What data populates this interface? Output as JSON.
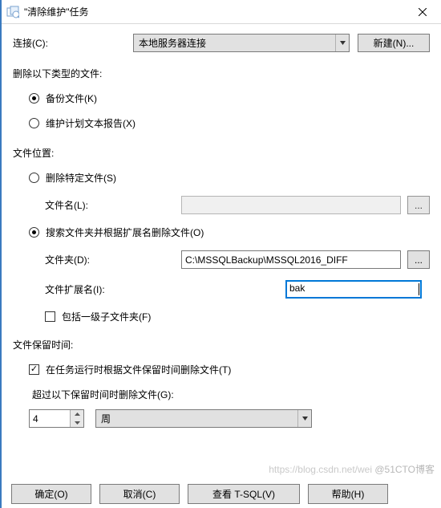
{
  "window": {
    "title": "\"清除维护\"任务"
  },
  "connection": {
    "label": "连接(C):",
    "selected": "本地服务器连接",
    "new_button": "新建(N)..."
  },
  "delete_type_section": {
    "label": "删除以下类型的文件:",
    "options": {
      "backup": {
        "label": "备份文件(K)",
        "selected": true
      },
      "report": {
        "label": "维护计划文本报告(X)",
        "selected": false
      }
    }
  },
  "file_location_section": {
    "label": "文件位置:",
    "options": {
      "specific": {
        "label": "删除特定文件(S)",
        "selected": false
      },
      "search": {
        "label": "搜索文件夹并根据扩展名删除文件(O)",
        "selected": true
      }
    },
    "fields": {
      "filename_label": "文件名(L):",
      "filename_value": "",
      "folder_label": "文件夹(D):",
      "folder_value": "C:\\MSSQLBackup\\MSSQL2016_DIFF",
      "ext_label": "文件扩展名(I):",
      "ext_value": "bak",
      "include_sub_label": "包括一级子文件夹(F)",
      "include_sub_checked": false,
      "browse_btn": "..."
    }
  },
  "retention_section": {
    "label": "文件保留时间:",
    "enable_label": "在任务运行时根据文件保留时间删除文件(T)",
    "enable_checked": true,
    "older_than_label": "超过以下保留时间时删除文件(G):",
    "value": "4",
    "unit": "周"
  },
  "buttons": {
    "ok": "确定(O)",
    "cancel": "取消(C)",
    "tsql": "查看 T-SQL(V)",
    "help": "帮助(H)"
  },
  "watermark": {
    "line1": "https://blog.csdn.net/wei",
    "line2": "@51CTO博客"
  }
}
